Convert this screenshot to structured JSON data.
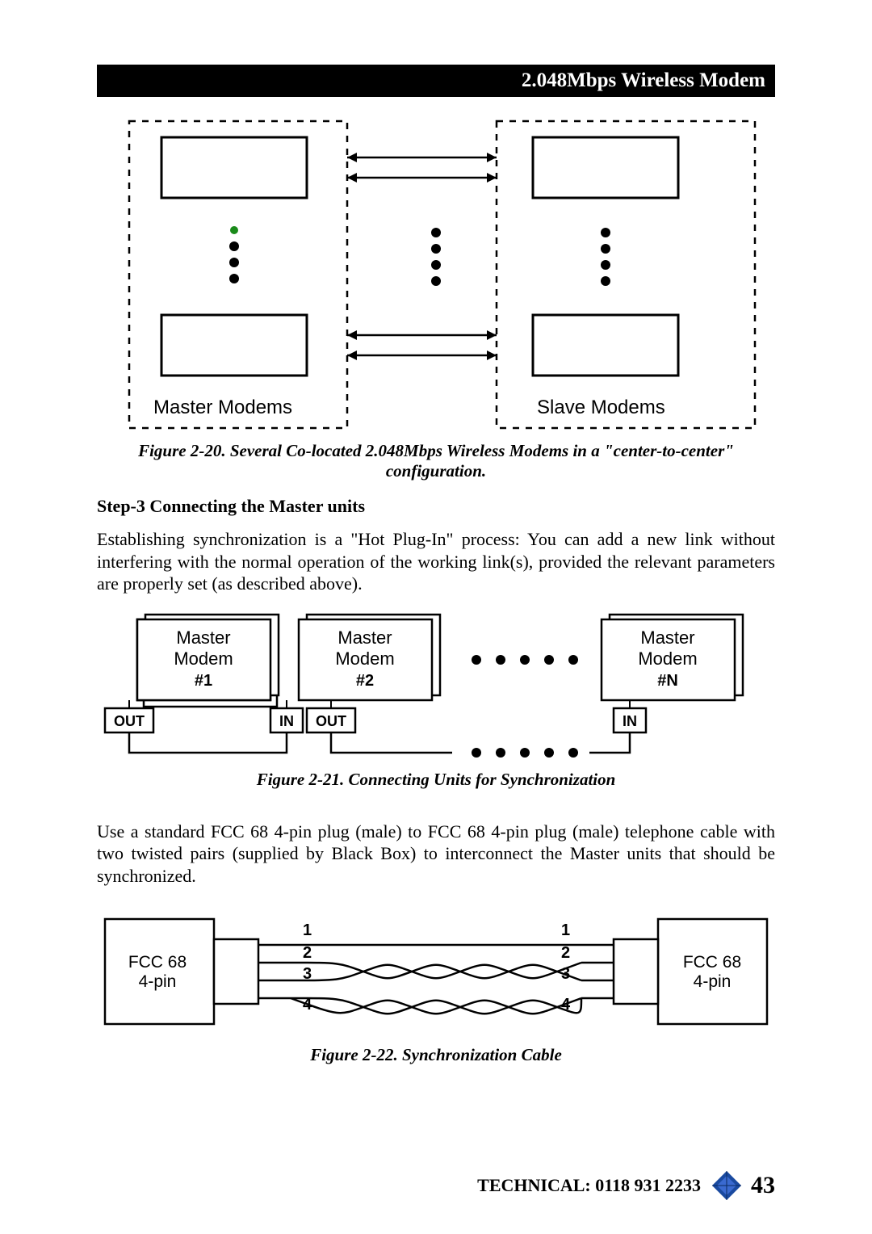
{
  "header": {
    "title": "2.048Mbps Wireless Modem"
  },
  "fig20": {
    "master_label": "Master Modems",
    "slave_label": "Slave Modems",
    "caption": "Figure 2-20. Several Co-located 2.048Mbps Wireless Modems in a \"center-to-center\" configuration."
  },
  "step3": {
    "title": "Step-3 Connecting the Master units",
    "body": "Establishing synchronization is a \"Hot Plug-In\" process: You can add a new link without interfering with the normal operation of the working link(s), provided the relevant parameters are properly set (as described above)."
  },
  "fig21": {
    "m1_l1": "Master",
    "m1_l2": "Modem",
    "m1_l3": "#1",
    "m2_l1": "Master",
    "m2_l2": "Modem",
    "m2_l3": "#2",
    "mn_l1": "Master",
    "mn_l2": "Modem",
    "mn_l3": "#N",
    "out": "OUT",
    "in": "IN",
    "caption": "Figure 2-21. Connecting Units for Synchronization"
  },
  "para2": "Use a standard FCC 68 4-pin plug (male) to FCC 68 4-pin plug (male) telephone cable with two twisted pairs (supplied by Black Box) to interconnect the Master units that should be synchronized.",
  "fig22": {
    "left_l1": "FCC 68",
    "left_l2": "4-pin",
    "right_l1": "FCC 68",
    "right_l2": "4-pin",
    "p1": "1",
    "p2": "2",
    "p3": "3",
    "p4": "4",
    "caption": "Figure 2-22. Synchronization Cable"
  },
  "footer": {
    "technical": "TECHNICAL: 0118 931 2233",
    "page": "43"
  }
}
